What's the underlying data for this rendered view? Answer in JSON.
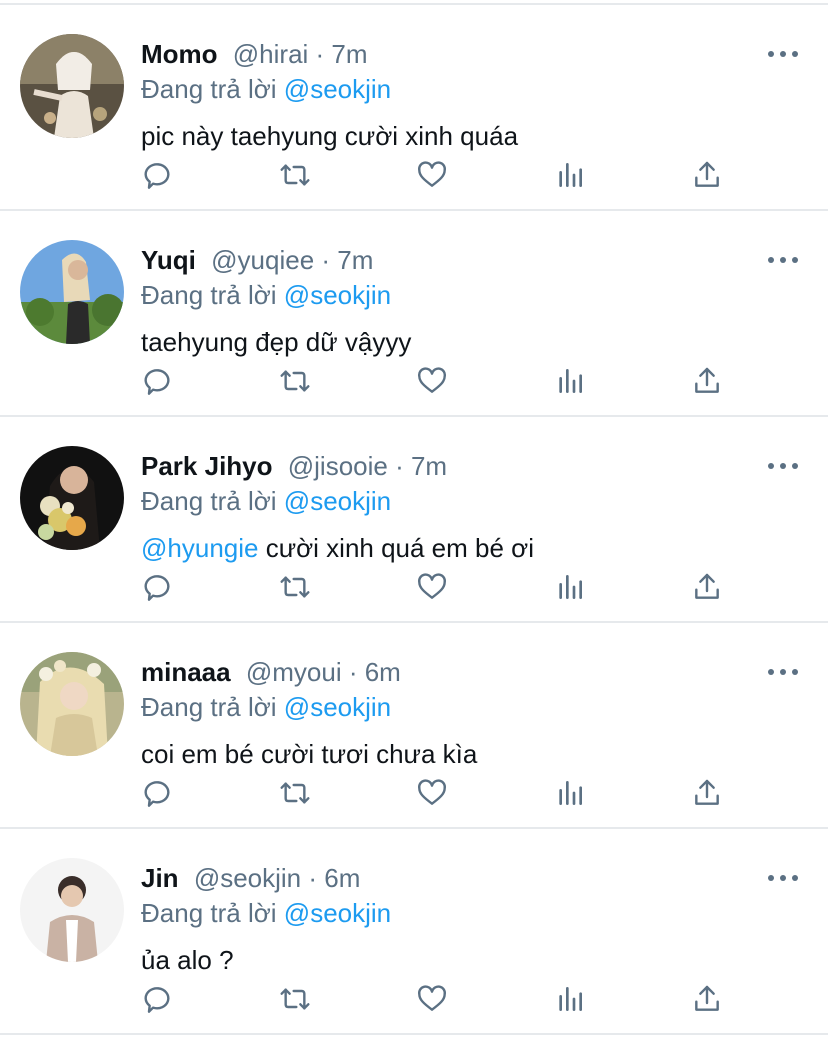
{
  "feed": {
    "replying_prefix": "Đang trả lời",
    "tweets": [
      {
        "name": "Momo",
        "handle": "@hirai",
        "sep": " · ",
        "time": "7m",
        "reply_to": "@seokjin",
        "mention": "",
        "text": "pic này taehyung cười xinh quáa"
      },
      {
        "name": "Yuqi",
        "handle": "@yuqiee",
        "sep": " · ",
        "time": "7m",
        "reply_to": "@seokjin",
        "mention": "",
        "text": "taehyung đẹp dữ vậyyy"
      },
      {
        "name": "Park Jihyo",
        "handle": "@jisooie",
        "sep": " · ",
        "time": "7m",
        "reply_to": "@seokjin",
        "mention": "@hyungie",
        "text": " cười xinh quá em bé ơi"
      },
      {
        "name": "minaaa",
        "handle": "@myoui",
        "sep": " · ",
        "time": "6m",
        "reply_to": "@seokjin",
        "mention": "",
        "text": "coi em bé cười tươi chưa kìa"
      },
      {
        "name": "Jin",
        "handle": "@seokjin",
        "sep": " · ",
        "time": "6m",
        "reply_to": "@seokjin",
        "mention": "",
        "text": "ủa alo ?"
      }
    ]
  },
  "colors": {
    "text": "#0f1419",
    "secondary": "#5b7083",
    "link": "#1d9bf0",
    "divider": "#e6e9ec"
  },
  "icons": {
    "actions": [
      "reply-icon",
      "retweet-icon",
      "like-icon",
      "analytics-icon",
      "share-icon"
    ],
    "more": "more-icon"
  }
}
